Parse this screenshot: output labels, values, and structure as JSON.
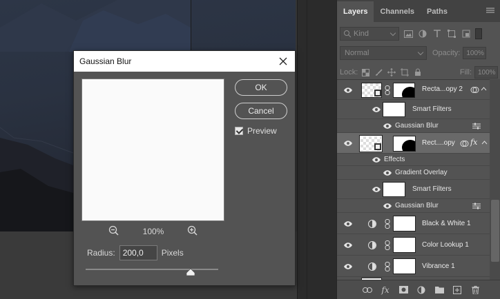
{
  "dialog": {
    "title": "Gaussian Blur",
    "ok_label": "OK",
    "cancel_label": "Cancel",
    "preview_label": "Preview",
    "preview_checked": true,
    "zoom_value": "100%",
    "radius_label": "Radius:",
    "radius_value": "200,0",
    "radius_unit": "Pixels"
  },
  "panel": {
    "tabs": [
      {
        "label": "Layers",
        "active": true
      },
      {
        "label": "Channels",
        "active": false
      },
      {
        "label": "Paths",
        "active": false
      }
    ],
    "filter_kind": "Kind",
    "blend_mode": "Normal",
    "opacity_label": "Opacity:",
    "opacity_value": "100%",
    "lock_label": "Lock:",
    "fill_label": "Fill:",
    "fill_value": "100%",
    "layers": [
      {
        "name": "Recta...opy 2",
        "sub": [
          {
            "label": "Smart Filters"
          },
          {
            "label": "Gaussian Blur"
          }
        ]
      },
      {
        "name": "Rect....opy",
        "effects_label": "Effects",
        "effect": "Gradient Overlay",
        "sub": [
          {
            "label": "Smart Filters"
          },
          {
            "label": "Gaussian Blur"
          }
        ]
      },
      {
        "name": "Black & White 1"
      },
      {
        "name": "Color Lookup 1"
      },
      {
        "name": "Vibrance 1"
      }
    ]
  },
  "colors": {
    "panel_bg": "#535353",
    "selected_row": "#696969",
    "dialog_bg": "#535353"
  }
}
